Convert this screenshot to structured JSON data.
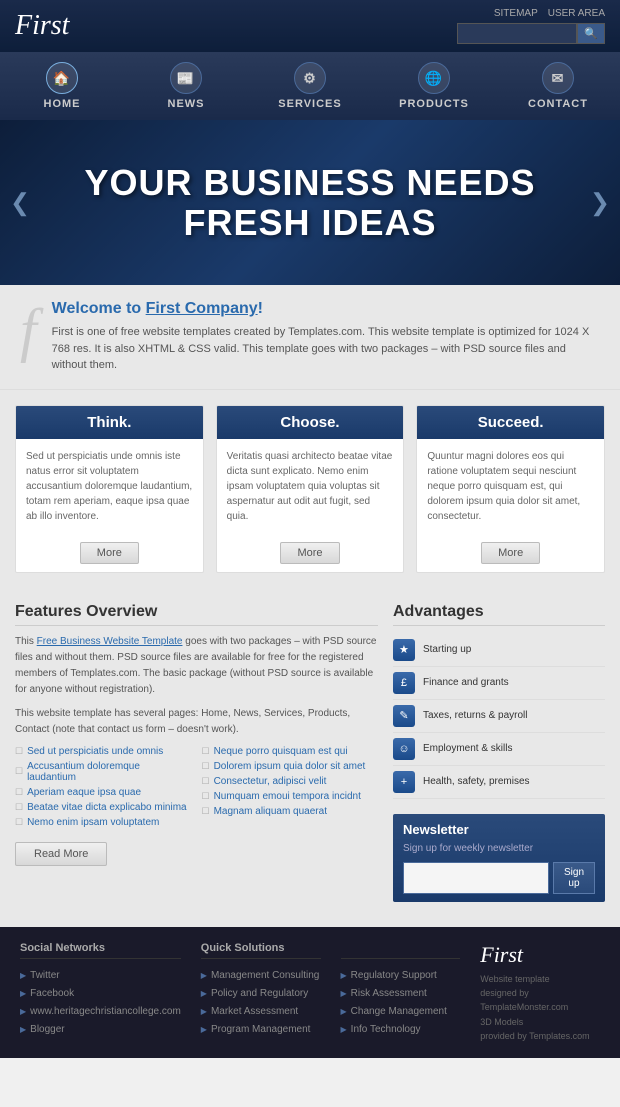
{
  "header": {
    "logo": "First",
    "links": [
      "SITEMAP",
      "USER AREA"
    ],
    "search_placeholder": ""
  },
  "nav": {
    "items": [
      {
        "label": "HOME",
        "icon": "🏠"
      },
      {
        "label": "NEWS",
        "icon": "📰"
      },
      {
        "label": "SERVICES",
        "icon": "⚙"
      },
      {
        "label": "PRODUCTS",
        "icon": "🌐"
      },
      {
        "label": "CONTACT",
        "icon": "✉"
      }
    ]
  },
  "hero": {
    "line1": "YOUR BUSINESS NEEDS",
    "line2": "FRESH IDEAS"
  },
  "welcome": {
    "letter": "f",
    "heading_prefix": "Welcome to ",
    "heading_link": "First Company",
    "heading_suffix": "!",
    "body": "First is one of free website templates created by Templates.com. This website template is optimized for 1024 X 768 res. It is also XHTML & CSS valid. This template goes with two packages – with PSD source files and without them."
  },
  "columns": [
    {
      "header": "Think.",
      "body": "Sed ut perspiciatis unde omnis iste natus error sit voluptatem accusantium doloremque laudantium, totam rem aperiam, eaque ipsa quae ab illo inventore.",
      "more": "More"
    },
    {
      "header": "Choose.",
      "body": "Veritatis quasi architecto beatae vitae dicta sunt explicato. Nemo enim ipsam voluptatem quia voluptas sit aspernatur aut odit aut fugit, sed quia.",
      "more": "More"
    },
    {
      "header": "Succeed.",
      "body": "Quuntur magni dolores eos qui ratione voluptatem sequi nesciunt neque porro quisquam est, qui dolorem ipsum quia dolor sit amet, consectetur.",
      "more": "More"
    }
  ],
  "features": {
    "title": "Features Overview",
    "para1": "This Free Business Website Template goes with two packages – with PSD source files and without them. PSD source files are available for free for the registered members of Templates.com. The basic package (without PSD source is available for anyone without registration).",
    "para2": "This website template has several pages: Home, News, Services, Products, Contact (note that contact us form – doesn't work).",
    "left_links": [
      "Sed ut perspiciatis unde omnis",
      "Accusantium doloremque laudantium",
      "Aperiam eaque ipsa quae",
      "Beatae vitae dicta explicabo minima",
      "Nemo enim ipsam voluptatem"
    ],
    "right_links": [
      "Neque porro quisquam est qui",
      "Dolorem ipsum quia dolor sit amet",
      "Consectetur, adipisci velit",
      "Numquam emoui tempora incidnt",
      "Magnam aliquam quaerat"
    ],
    "read_more": "Read More"
  },
  "advantages": {
    "title": "Advantages",
    "items": [
      {
        "label": "Starting up",
        "icon": "★"
      },
      {
        "label": "Finance and grants",
        "icon": "£"
      },
      {
        "label": "Taxes, returns & payroll",
        "icon": "✎"
      },
      {
        "label": "Employment & skills",
        "icon": "☺"
      },
      {
        "label": "Health, safety, premises",
        "icon": "+"
      }
    ]
  },
  "newsletter": {
    "title": "Newsletter",
    "desc": "Sign up for weekly newsletter",
    "sign_up": "Sign up",
    "placeholder": ""
  },
  "footer": {
    "social_title": "Social Networks",
    "social_links": [
      "Twitter",
      "Facebook",
      "www.heritagechristiancollege.com",
      "Blogger"
    ],
    "solutions_title": "Quick Solutions",
    "solutions_links": [
      "Management Consulting",
      "Policy and Regulatory",
      "Market Assessment",
      "Program Management"
    ],
    "solutions2_links": [
      "Regulatory Support",
      "Risk Assessment",
      "Change Management",
      "Info Technology"
    ],
    "logo": "First",
    "website_template": "Website template",
    "designed_by": "designed by TemplateMonster.com",
    "models_label": "3D Models",
    "provided_by": "provided by Templates.com"
  }
}
